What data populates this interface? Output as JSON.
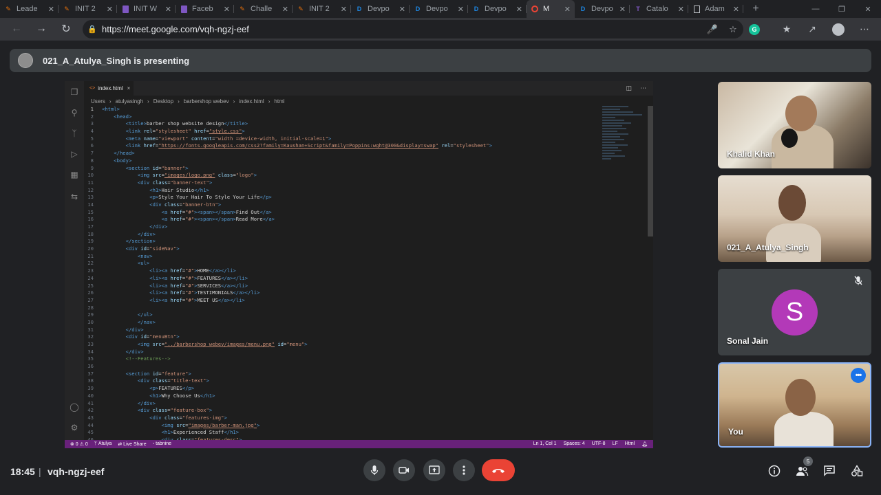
{
  "browser": {
    "tabs": [
      {
        "label": "Leade",
        "favicon": "pencil-icon",
        "color": "#e8710a"
      },
      {
        "label": "INIT 2",
        "favicon": "pencil-icon",
        "color": "#e8710a"
      },
      {
        "label": "INIT W",
        "favicon": "form-icon",
        "color": "#7e57c2"
      },
      {
        "label": "Faceb",
        "favicon": "form-icon",
        "color": "#7e57c2"
      },
      {
        "label": "Challe",
        "favicon": "pencil-icon",
        "color": "#e8710a"
      },
      {
        "label": "INIT 2",
        "favicon": "pencil-icon",
        "color": "#e8710a"
      },
      {
        "label": "Devpo",
        "favicon": "D",
        "color": "#1e88e5"
      },
      {
        "label": "Devpo",
        "favicon": "D",
        "color": "#1e88e5"
      },
      {
        "label": "Devpo",
        "favicon": "D",
        "color": "#1e88e5"
      },
      {
        "label": "M",
        "favicon": "meet-icon",
        "color": "#34a853"
      },
      {
        "label": "Devpo",
        "favicon": "D",
        "color": "#1e88e5"
      },
      {
        "label": "Catalo",
        "favicon": "T",
        "color": "#7e57c2"
      },
      {
        "label": "Adam",
        "favicon": "doc-icon",
        "color": "#bdc1c6"
      }
    ],
    "active_tab_index": 9,
    "url": "https://meet.google.com/vqh-ngzj-eef"
  },
  "meet": {
    "presenting_text": "021_A_Atulya_Singh is presenting",
    "clock": "18:45",
    "divider": "|",
    "meeting_code": "vqh-ngzj-eef",
    "participant_count": "5",
    "participants": [
      {
        "name": "Khalid Khan"
      },
      {
        "name": "021_A_Atulya_Singh"
      },
      {
        "name": "Sonal Jain",
        "initial": "S",
        "avatar_color": "#b339b8",
        "muted": true
      },
      {
        "name": "You"
      }
    ]
  },
  "vscode": {
    "file_tab": "index.html",
    "breadcrumb": [
      "Users",
      "atulyasingh",
      "Desktop",
      "barbershop webev",
      "index.html",
      "html"
    ],
    "status_left": [
      "⊗ 0 ⚠ 0",
      "ᛘ Atulya",
      "⇄ Live Share",
      "◦ tabnine"
    ],
    "status_right": [
      "Ln 1, Col 1",
      "Spaces: 4",
      "UTF-8",
      "LF",
      "Html"
    ],
    "lines": [
      [
        [
          "tg",
          "<html>"
        ]
      ],
      [
        [
          "tg",
          "    <head>"
        ]
      ],
      [
        [
          "tg",
          "        <title>"
        ],
        [
          "tx",
          "barber shop website design"
        ],
        [
          "tg",
          "</title>"
        ]
      ],
      [
        [
          "tg",
          "        <link "
        ],
        [
          "at",
          "rel"
        ],
        [
          "tx",
          "="
        ],
        [
          "sv",
          "\"stylesheet\""
        ],
        [
          "at",
          " href"
        ],
        [
          "tx",
          "="
        ],
        [
          "sv",
          "\"style.css\""
        ],
        [
          "tg",
          ">"
        ]
      ],
      [
        [
          "tg",
          "        <meta "
        ],
        [
          "at",
          "name"
        ],
        [
          "tx",
          "="
        ],
        [
          "sv",
          "\"viewport\""
        ],
        [
          "at",
          " content"
        ],
        [
          "tx",
          "="
        ],
        [
          "sv",
          "\"width =device-width, initial-scale=1\""
        ],
        [
          "tg",
          ">"
        ]
      ],
      [
        [
          "tg",
          "        <link "
        ],
        [
          "at",
          "href"
        ],
        [
          "tx",
          "="
        ],
        [
          "sv",
          "\"https://fonts.googleapis.com/css2?family=Kaushan+Script&family=Poppins:wght@300&display=swap\""
        ],
        [
          "at",
          " rel"
        ],
        [
          "tx",
          "="
        ],
        [
          "sv",
          "\"stylesheet\""
        ],
        [
          "tg",
          ">"
        ]
      ],
      [
        [
          "tg",
          "    </head>"
        ]
      ],
      [
        [
          "tg",
          "    <body>"
        ]
      ],
      [
        [
          "tg",
          "        <section "
        ],
        [
          "at",
          "id"
        ],
        [
          "tx",
          "="
        ],
        [
          "sv",
          "\"banner\""
        ],
        [
          "tg",
          ">"
        ]
      ],
      [
        [
          "tg",
          "            <img "
        ],
        [
          "at",
          "src"
        ],
        [
          "tx",
          "="
        ],
        [
          "sv",
          "\"images/logo.png\""
        ],
        [
          "at",
          " class"
        ],
        [
          "tx",
          "="
        ],
        [
          "sv",
          "\"logo\""
        ],
        [
          "tg",
          ">"
        ]
      ],
      [
        [
          "tg",
          "            <div "
        ],
        [
          "at",
          "class"
        ],
        [
          "tx",
          "="
        ],
        [
          "sv",
          "\"banner-text\""
        ],
        [
          "tg",
          ">"
        ]
      ],
      [
        [
          "tg",
          "                <h1>"
        ],
        [
          "tx",
          "Hair Studio"
        ],
        [
          "tg",
          "</h1>"
        ]
      ],
      [
        [
          "tg",
          "                <p>"
        ],
        [
          "tx",
          "Style Your Hair To Style Your Life"
        ],
        [
          "tg",
          "</p>"
        ]
      ],
      [
        [
          "tg",
          "                <div "
        ],
        [
          "at",
          "class"
        ],
        [
          "tx",
          "="
        ],
        [
          "sv",
          "\"banner-btn\""
        ],
        [
          "tg",
          ">"
        ]
      ],
      [
        [
          "tg",
          "                    <a "
        ],
        [
          "at",
          "href"
        ],
        [
          "tx",
          "="
        ],
        [
          "sv",
          "\"#\""
        ],
        [
          "tg",
          "><span></span>"
        ],
        [
          "tx",
          "Find Out"
        ],
        [
          "tg",
          "</a>"
        ]
      ],
      [
        [
          "tg",
          "                    <a "
        ],
        [
          "at",
          "href"
        ],
        [
          "tx",
          "="
        ],
        [
          "sv",
          "\"#\""
        ],
        [
          "tg",
          "><span></span>"
        ],
        [
          "tx",
          "Read More"
        ],
        [
          "tg",
          "</a>"
        ]
      ],
      [
        [
          "tg",
          "                </div>"
        ]
      ],
      [
        [
          "tg",
          "            </div>"
        ]
      ],
      [
        [
          "tg",
          "        </section>"
        ]
      ],
      [
        [
          "tg",
          "        <div "
        ],
        [
          "at",
          "id"
        ],
        [
          "tx",
          "="
        ],
        [
          "sv",
          "\"sideNav\""
        ],
        [
          "tg",
          ">"
        ]
      ],
      [
        [
          "tg",
          "            <nav>"
        ]
      ],
      [
        [
          "tg",
          "            <ul>"
        ]
      ],
      [
        [
          "tg",
          "                <li><a "
        ],
        [
          "at",
          "href"
        ],
        [
          "tx",
          "="
        ],
        [
          "sv",
          "\"#\""
        ],
        [
          "tg",
          ">"
        ],
        [
          "tx",
          "HOME"
        ],
        [
          "tg",
          "</a></li>"
        ]
      ],
      [
        [
          "tg",
          "                <li><a "
        ],
        [
          "at",
          "href"
        ],
        [
          "tx",
          "="
        ],
        [
          "sv",
          "\"#\""
        ],
        [
          "tg",
          ">"
        ],
        [
          "tx",
          "FEATURES"
        ],
        [
          "tg",
          "</a></li>"
        ]
      ],
      [
        [
          "tg",
          "                <li><a "
        ],
        [
          "at",
          "href"
        ],
        [
          "tx",
          "="
        ],
        [
          "sv",
          "\"#\""
        ],
        [
          "tg",
          ">"
        ],
        [
          "tx",
          "SERVICES"
        ],
        [
          "tg",
          "</a></li>"
        ]
      ],
      [
        [
          "tg",
          "                <li><a "
        ],
        [
          "at",
          "href"
        ],
        [
          "tx",
          "="
        ],
        [
          "sv",
          "\"#\""
        ],
        [
          "tg",
          ">"
        ],
        [
          "tx",
          "TESTIMONIALS"
        ],
        [
          "tg",
          "</a></li>"
        ]
      ],
      [
        [
          "tg",
          "                <li><a "
        ],
        [
          "at",
          "href"
        ],
        [
          "tx",
          "="
        ],
        [
          "sv",
          "\"#\""
        ],
        [
          "tg",
          ">"
        ],
        [
          "tx",
          "MEET US"
        ],
        [
          "tg",
          "</a></li>"
        ]
      ],
      [
        [
          "tx",
          ""
        ]
      ],
      [
        [
          "tg",
          "            </ul>"
        ]
      ],
      [
        [
          "tg",
          "            </nav>"
        ]
      ],
      [
        [
          "tg",
          "        </div>"
        ]
      ],
      [
        [
          "tg",
          "        <div "
        ],
        [
          "at",
          "id"
        ],
        [
          "tx",
          "="
        ],
        [
          "sv",
          "\"menuBtn\""
        ],
        [
          "tg",
          ">"
        ]
      ],
      [
        [
          "tg",
          "            <img "
        ],
        [
          "at",
          "src"
        ],
        [
          "tx",
          "="
        ],
        [
          "sv",
          "\"../barbershop webev/images/menu.png\""
        ],
        [
          "at",
          " id"
        ],
        [
          "tx",
          "="
        ],
        [
          "sv",
          "\"menu\""
        ],
        [
          "tg",
          ">"
        ]
      ],
      [
        [
          "tg",
          "        </div>"
        ]
      ],
      [
        [
          "cm",
          "        <!--Features-->"
        ]
      ],
      [
        [
          "tx",
          ""
        ]
      ],
      [
        [
          "tg",
          "        <section "
        ],
        [
          "at",
          "id"
        ],
        [
          "tx",
          "="
        ],
        [
          "sv",
          "\"feature\""
        ],
        [
          "tg",
          ">"
        ]
      ],
      [
        [
          "tg",
          "            <div "
        ],
        [
          "at",
          "class"
        ],
        [
          "tx",
          "="
        ],
        [
          "sv",
          "\"title-text\""
        ],
        [
          "tg",
          ">"
        ]
      ],
      [
        [
          "tg",
          "                <p>"
        ],
        [
          "tx",
          "FEATURES"
        ],
        [
          "tg",
          "</p>"
        ]
      ],
      [
        [
          "tg",
          "                <h1>"
        ],
        [
          "tx",
          "Why Choose Us"
        ],
        [
          "tg",
          "</h1>"
        ]
      ],
      [
        [
          "tg",
          "            </div>"
        ]
      ],
      [
        [
          "tg",
          "            <div "
        ],
        [
          "at",
          "class"
        ],
        [
          "tx",
          "="
        ],
        [
          "sv",
          "\"feature-box\""
        ],
        [
          "tg",
          ">"
        ]
      ],
      [
        [
          "tg",
          "                <div "
        ],
        [
          "at",
          "class"
        ],
        [
          "tx",
          "="
        ],
        [
          "sv",
          "\"features-img\""
        ],
        [
          "tg",
          ">"
        ]
      ],
      [
        [
          "tg",
          "                    <img "
        ],
        [
          "at",
          "src"
        ],
        [
          "tx",
          "="
        ],
        [
          "sv",
          "\"images/barber-man.jpg\""
        ],
        [
          "tg",
          ">"
        ]
      ],
      [
        [
          "tg",
          "                    <h1>"
        ],
        [
          "tx",
          "Experienced Staff"
        ],
        [
          "tg",
          "</h1>"
        ]
      ],
      [
        [
          "tg",
          "                    <div "
        ],
        [
          "at",
          "class"
        ],
        [
          "tx",
          "="
        ],
        [
          "sv",
          "\"features-desc\""
        ],
        [
          "tg",
          ">"
        ]
      ]
    ]
  }
}
